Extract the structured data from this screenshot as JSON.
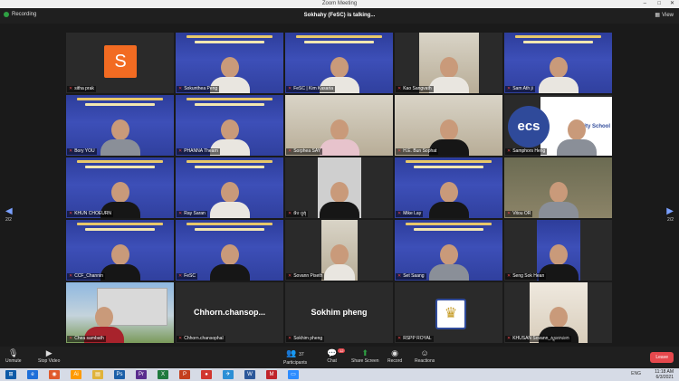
{
  "window": {
    "title": "Zoom Meeting",
    "controls": [
      "–",
      "□",
      "✕"
    ]
  },
  "topbar": {
    "recording": "Recording",
    "talking": "Sokhahy (FeSC) is talking...",
    "view": "View"
  },
  "page_indicator": {
    "left": "2/2",
    "right": "2/2"
  },
  "participants": [
    {
      "name": "sitha prak",
      "avatar": "S"
    },
    {
      "name": "Sokunthea Peng"
    },
    {
      "name": "FeSC | Kim Kasaria"
    },
    {
      "name": "Kao Sangvath"
    },
    {
      "name": "Sam Ath ji"
    },
    {
      "name": "Bory YOU"
    },
    {
      "name": "PHANNA Thearn"
    },
    {
      "name": "Sorphea SAY"
    },
    {
      "name": "H.E. Bun Sophat"
    },
    {
      "name": "Samphors Heng",
      "logo": "ecs",
      "logo_text": "nity School"
    },
    {
      "name": "KHUN CHOEURN"
    },
    {
      "name": "Ray Saran"
    },
    {
      "name": "ផឹប ពួតុំ"
    },
    {
      "name": "Mike Lay"
    },
    {
      "name": "Vitou OR"
    },
    {
      "name": "CCF_Channin"
    },
    {
      "name": "FeSC"
    },
    {
      "name": "Sovann Piseth"
    },
    {
      "name": "Set Saang"
    },
    {
      "name": "Seng Sok Hean"
    },
    {
      "name": "Chea sambath"
    },
    {
      "name": "Chhorn.chansophal",
      "big": "Chhorn.chansop..."
    },
    {
      "name": "Sokhim pheng",
      "big": "Sokhim pheng"
    },
    {
      "name": "RSPP ROYAL"
    },
    {
      "name": "KHUSAN Sovann_ស្ទុនចាន់ខា"
    }
  ],
  "toolbar": {
    "unmute": "Unmute",
    "stop_video": "Stop Video",
    "participants": "Participants",
    "participants_count": "37",
    "chat": "Chat",
    "chat_badge": "12",
    "share": "Share Screen",
    "record": "Record",
    "reactions": "Reactions",
    "leave": "Leave"
  },
  "taskbar": {
    "lang": "ENG",
    "time": "11:18 AM",
    "date": "6/3/2021",
    "apps": [
      {
        "label": "⊞",
        "color": "#0d5aa7"
      },
      {
        "label": "e",
        "color": "#1e6fd9"
      },
      {
        "label": "◉",
        "color": "#e05a2b"
      },
      {
        "label": "Ai",
        "color": "#ff9a00"
      },
      {
        "label": "▤",
        "color": "#e0b33a"
      },
      {
        "label": "Ps",
        "color": "#1b5fa8"
      },
      {
        "label": "Pr",
        "color": "#5a2d8e"
      },
      {
        "label": "X",
        "color": "#1f7a3e"
      },
      {
        "label": "P",
        "color": "#c43e1c"
      },
      {
        "label": "●",
        "color": "#d1362f"
      },
      {
        "label": "✈",
        "color": "#2b8fd6"
      },
      {
        "label": "W",
        "color": "#2b579a"
      },
      {
        "label": "M",
        "color": "#c0242b"
      },
      {
        "label": "▭",
        "color": "#2d8cff"
      }
    ]
  }
}
